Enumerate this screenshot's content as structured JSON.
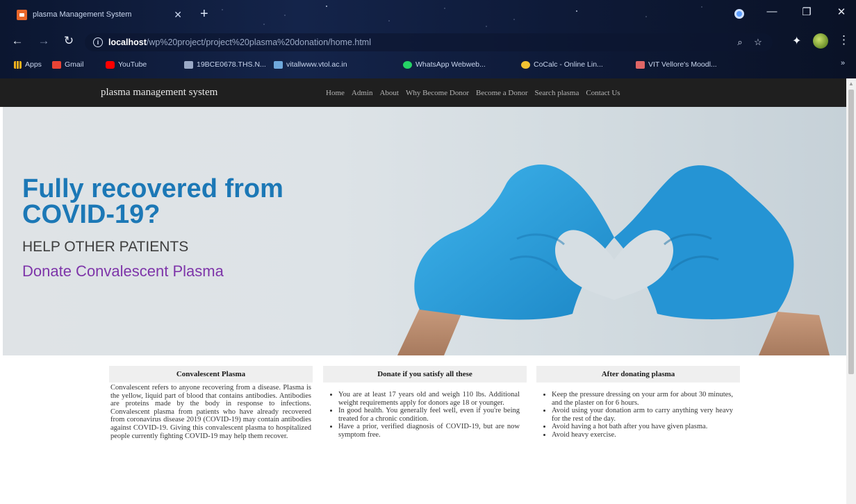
{
  "browser": {
    "tab_title": "plasma Management System",
    "tab_close": "✕",
    "new_tab": "+",
    "url_host": "localhost",
    "url_path": "/wp%20project/project%20plasma%20donation/home.html",
    "window_controls": {
      "minimize": "—",
      "restore": "❐",
      "close": "✕"
    },
    "bookmarks": [
      {
        "label": "Apps",
        "color": "#f2b01e"
      },
      {
        "label": "Gmail",
        "color": "#ea4335"
      },
      {
        "label": "YouTube",
        "color": "#ff0000"
      },
      {
        "label": "19BCE0678.THS.N...",
        "color": "#9aa9c6"
      },
      {
        "label": "vitallwww.vtol.ac.in",
        "color": "#6fa8dc"
      },
      {
        "label": "WhatsApp Webweb...",
        "color": "#25d366"
      },
      {
        "label": "CoCalc - Online Lin...",
        "color": "#f1c232"
      },
      {
        "label": "VIT Vellore's Moodl...",
        "color": "#e06666"
      }
    ],
    "bookmarks_more": "»"
  },
  "site": {
    "brand": "plasma management system",
    "nav": [
      "Home",
      "Admin",
      "About",
      "Why Become Donor",
      "Become a Donor",
      "Search plasma",
      "Contact Us"
    ]
  },
  "hero": {
    "title": "Fully recovered from COVID-19?",
    "subtitle": "HELP OTHER PATIENTS",
    "cta": "Donate Convalescent Plasma",
    "colors": {
      "title": "#1c78b6",
      "cta": "#7e35a9",
      "glove": "#2aa3e0"
    }
  },
  "cards": [
    {
      "title": "Convalescent Plasma",
      "text": "Convalescent refers to anyone recovering from a disease. Plasma is the yellow, liquid part of blood that contains antibodies. Antibodies are proteins made by the body in response to infections. Convalescent plasma from patients who have already recovered from coronavirus disease 2019 (COVID-19) may contain antibodies against COVID-19. Giving this convalescent plasma to hospitalized people currently fighting COVID-19 may help them recover."
    },
    {
      "title": "Donate if you satisfy all these",
      "items": [
        "You are at least 17 years old and weigh 110 lbs. Additional weight requirements apply for donors age 18 or younger.",
        "In good health. You generally feel well, even if you're being treated for a chronic condition.",
        "Have a prior, verified diagnosis of COVID-19, but are now symptom free."
      ]
    },
    {
      "title": "After donating plasma",
      "items": [
        "Keep the pressure dressing on your arm for about 30 minutes, and the plaster on for 6 hours.",
        "Avoid using your donation arm to carry anything very heavy for the rest of the day.",
        "Avoid having a hot bath after you have given plasma.",
        "Avoid heavy exercise."
      ]
    }
  ]
}
